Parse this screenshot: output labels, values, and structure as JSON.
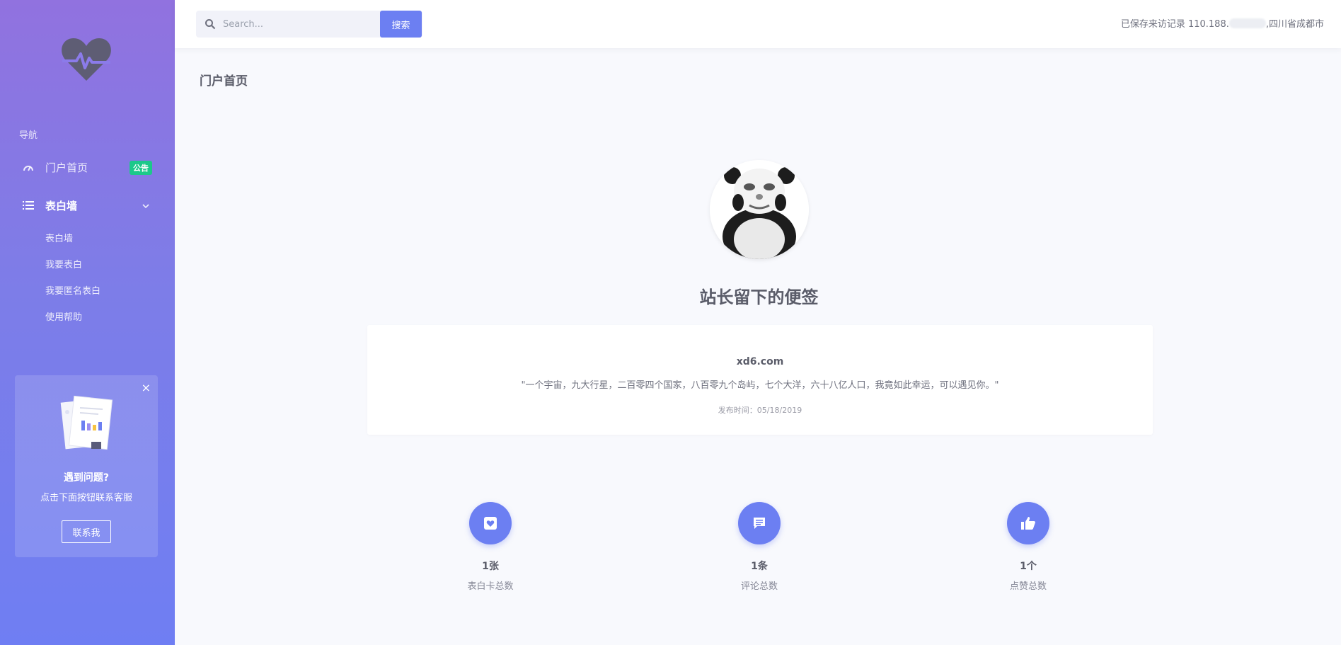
{
  "sidebar": {
    "nav_heading": "导航",
    "items": [
      {
        "label": "门户首页",
        "badge": "公告"
      },
      {
        "label": "表白墙"
      }
    ],
    "sub_items": [
      "表白墙",
      "我要表白",
      "我要匿名表白",
      "使用帮助"
    ],
    "help": {
      "title": "遇到问题?",
      "description": "点击下面按钮联系客服",
      "button": "联系我",
      "close": "×"
    }
  },
  "topbar": {
    "search_placeholder": "Search...",
    "search_button": "搜索",
    "visit_prefix": "已保存来访记录 110.188.",
    "visit_suffix": ",四川省成都市"
  },
  "main": {
    "page_title": "门户首页",
    "note_title": "站长留下的便签",
    "note": {
      "author": "xd6.com",
      "text": "\"一个宇宙，九大行星，二百零四个国家，八百零九个岛屿，七个大洋，六十八亿人口，我竟如此幸运，可以遇见你。\"",
      "date": "发布时间：05/18/2019"
    },
    "stats": [
      {
        "value": "1张",
        "label": "表白卡总数",
        "icon": "card-heart-icon"
      },
      {
        "value": "1条",
        "label": "评论总数",
        "icon": "comment-icon"
      },
      {
        "value": "1个",
        "label": "点赞总数",
        "icon": "thumbs-up-icon"
      }
    ]
  },
  "colors": {
    "accent": "#6c7ff2",
    "badge": "#1cc88a",
    "sidebar_top": "#9172df",
    "sidebar_bottom": "#6f7ef3"
  }
}
